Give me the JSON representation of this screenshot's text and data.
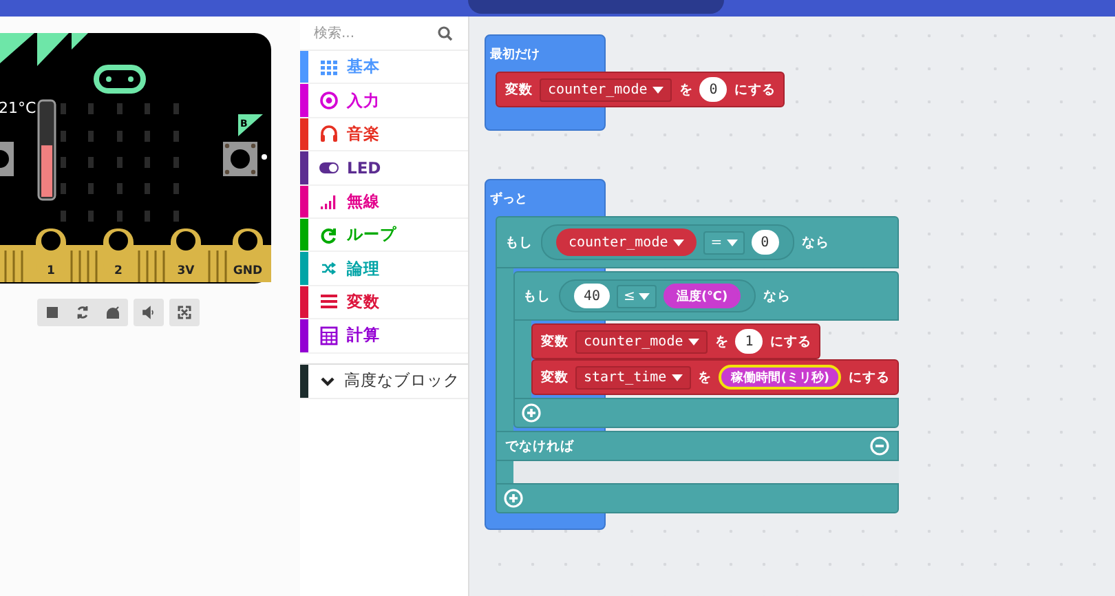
{
  "simulator": {
    "temperature": "21°C",
    "thermometer": {
      "level": 0.55
    },
    "button_b": "B",
    "pins": [
      "1",
      "2",
      "3V",
      "GND"
    ],
    "controls": [
      {
        "kind": "stop"
      },
      {
        "kind": "restart"
      },
      {
        "kind": "slow"
      },
      {
        "kind": "sound"
      },
      {
        "kind": "fullscreen"
      }
    ]
  },
  "toolbox": {
    "search": {
      "placeholder": "検索..."
    },
    "categories": [
      {
        "label": "基本",
        "color": "#4c97ff",
        "kind": "basic"
      },
      {
        "label": "入力",
        "color": "#d400d4",
        "kind": "input"
      },
      {
        "label": "音楽",
        "color": "#e63022",
        "kind": "music"
      },
      {
        "label": "LED",
        "color": "#5c2d91",
        "kind": "led"
      },
      {
        "label": "無線",
        "color": "#e3008c",
        "kind": "radio"
      },
      {
        "label": "ループ",
        "color": "#00aa00",
        "kind": "loops"
      },
      {
        "label": "論理",
        "color": "#00a4a6",
        "kind": "logic"
      },
      {
        "label": "変数",
        "color": "#dc143c",
        "kind": "variables"
      },
      {
        "label": "計算",
        "color": "#9400d3",
        "kind": "math"
      }
    ],
    "advanced": {
      "label": "高度なブロック",
      "expanded": false
    }
  },
  "workspace": {
    "stacks": [
      {
        "kind": "on_start",
        "label": "最初だけ",
        "body": [
          {
            "kind": "set",
            "keyword": "変数",
            "variable": "counter_mode",
            "to": "を",
            "value": {
              "kind": "number",
              "text": "0"
            },
            "suffix": "にする"
          }
        ]
      },
      {
        "kind": "forever",
        "label": "ずっと",
        "body": [
          {
            "kind": "if",
            "keyword": "もし",
            "left": {
              "kind": "variable",
              "text": "counter_mode"
            },
            "op": "=",
            "right": {
              "kind": "number",
              "text": "0"
            },
            "then": "なら",
            "body": [
              {
                "kind": "if",
                "keyword": "もし",
                "left": {
                  "kind": "number",
                  "text": "40"
                },
                "op": "≤",
                "right": {
                  "kind": "reporter",
                  "text": "温度(℃)",
                  "selected": false
                },
                "then": "なら",
                "body": [
                  {
                    "kind": "set",
                    "keyword": "変数",
                    "variable": "counter_mode",
                    "to": "を",
                    "value": {
                      "kind": "number",
                      "text": "1"
                    },
                    "suffix": "にする"
                  },
                  {
                    "kind": "set",
                    "keyword": "変数",
                    "variable": "start_time",
                    "to": "を",
                    "value": {
                      "kind": "reporter",
                      "text": "稼働時間(ミリ秒)",
                      "selected": true
                    },
                    "suffix": "にする"
                  }
                ]
              }
            ],
            "else": {
              "label": "でなければ"
            }
          }
        ]
      }
    ]
  }
}
